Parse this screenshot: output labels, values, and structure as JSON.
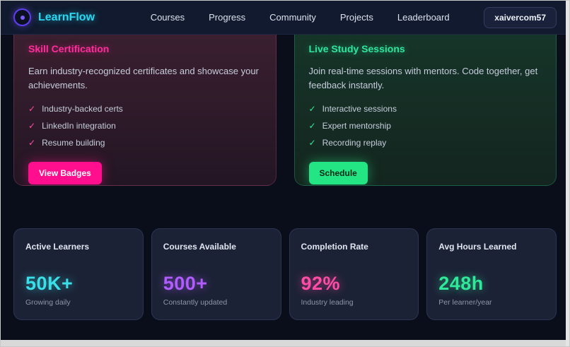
{
  "navbar": {
    "brand": "LearnFlow",
    "links": [
      {
        "label": "Courses"
      },
      {
        "label": "Progress"
      },
      {
        "label": "Community"
      },
      {
        "label": "Projects"
      },
      {
        "label": "Leaderboard"
      }
    ],
    "user_button": "xaivercom57"
  },
  "icons": {
    "check": "✓"
  },
  "feature_cards": [
    {
      "title": "Skill Certification",
      "accent_color": "#ff2d9b",
      "description": "Earn industry-recognized certificates and showcase your achievements.",
      "items": [
        "Industry-backed certs",
        "LinkedIn integration",
        "Resume building"
      ],
      "button": "View Badges",
      "button_color": "#ff0e8e"
    },
    {
      "title": "Live Study Sessions",
      "accent_color": "#2ee59d",
      "description": "Join real-time sessions with mentors. Code together, get feedback instantly.",
      "items": [
        "Interactive sessions",
        "Expert mentorship",
        "Recording replay"
      ],
      "button": "Schedule",
      "button_color": "#23e584"
    }
  ],
  "stats": [
    {
      "label": "Active Learners",
      "value": "50K+",
      "sub": "Growing daily",
      "color": "#3ae0e8"
    },
    {
      "label": "Courses Available",
      "value": "500+",
      "sub": "Constantly updated",
      "color": "#b15cff"
    },
    {
      "label": "Completion Rate",
      "value": "92%",
      "sub": "Industry leading",
      "color": "#ff4da6"
    },
    {
      "label": "Avg Hours Learned",
      "value": "248h",
      "sub": "Per learner/year",
      "color": "#2fe89a"
    }
  ]
}
